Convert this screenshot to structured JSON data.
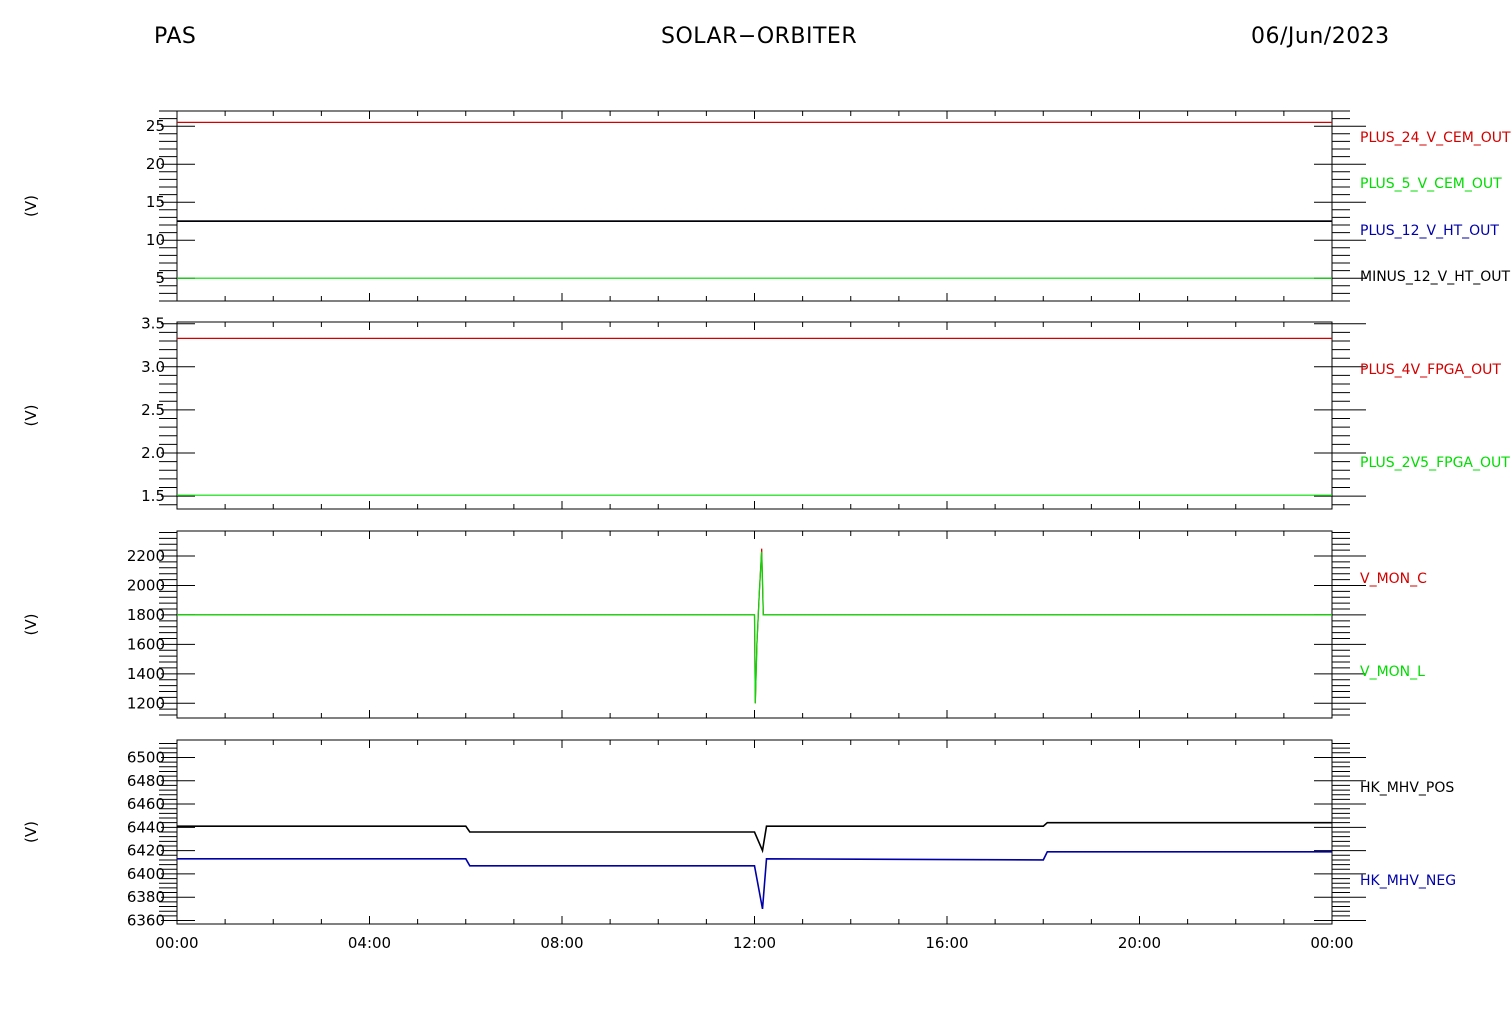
{
  "header": {
    "left": "PAS",
    "center": "SOLAR−ORBITER",
    "right": "06/Jun/2023"
  },
  "colors": {
    "red": "#d40000",
    "green": "#00dd00",
    "blue": "#0000aa",
    "black": "#000000"
  },
  "chart_data": [
    {
      "type": "line",
      "ylabel": "(V)",
      "ylim": [
        2,
        27
      ],
      "yticks": [
        5,
        10,
        15,
        20,
        25
      ],
      "x": [
        "00:00",
        "24:00"
      ],
      "series": [
        {
          "name": "PLUS_24_V_CEM_OUT",
          "color": "red",
          "values": [
            25.5,
            25.5
          ]
        },
        {
          "name": "PLUS_5_V_CEM_OUT",
          "color": "green",
          "values": [
            5.0,
            5.0
          ]
        },
        {
          "name": "PLUS_12_V_HT_OUT",
          "color": "blue",
          "values": [
            12.5,
            12.5
          ]
        },
        {
          "name": "MINUS_12_V_HT_OUT",
          "color": "black",
          "values": [
            12.5,
            12.5
          ]
        }
      ]
    },
    {
      "type": "line",
      "ylabel": "(V)",
      "ylim": [
        1.35,
        3.52
      ],
      "yticks": [
        1.5,
        2.0,
        2.5,
        3.0,
        3.5
      ],
      "ytick_labels": [
        "1.5",
        "2.0",
        "2.5",
        "3.0",
        "3.5"
      ],
      "x": [
        "00:00",
        "24:00"
      ],
      "series": [
        {
          "name": "PLUS_4V_FPGA_OUT",
          "color": "red",
          "values": [
            3.33,
            3.33
          ]
        },
        {
          "name": "PLUS_2V5_FPGA_OUT",
          "color": "green",
          "values": [
            1.51,
            1.51
          ]
        }
      ]
    },
    {
      "type": "line",
      "ylabel": "(V)",
      "ylim": [
        1100,
        2370
      ],
      "yticks": [
        1200,
        1400,
        1600,
        1800,
        2000,
        2200
      ],
      "x": [
        "00:00",
        "12:00",
        "12:01",
        "12:03",
        "12:06",
        "12:09",
        "12:11",
        "24:00"
      ],
      "series": [
        {
          "name": "V_MON_C",
          "color": "red",
          "values": [
            1800,
            1800,
            1200,
            1600,
            1950,
            2250,
            1800,
            1800
          ]
        },
        {
          "name": "V_MON_L",
          "color": "green",
          "values": [
            1800,
            1800,
            1200,
            1600,
            1950,
            2230,
            1800,
            1800
          ]
        }
      ]
    },
    {
      "type": "line",
      "ylabel": "(V)",
      "ylim": [
        6357,
        6515
      ],
      "yticks": [
        6360,
        6380,
        6400,
        6420,
        6440,
        6460,
        6480,
        6500
      ],
      "x": [
        "00:00",
        "00:05",
        "06:00",
        "06:05",
        "12:00",
        "12:10",
        "12:15",
        "18:00",
        "18:05",
        "24:00"
      ],
      "series": [
        {
          "name": "HK_MHV_POS",
          "color": "black",
          "values": [
            6441,
            6441,
            6441,
            6436,
            6436,
            6420,
            6441,
            6441,
            6444,
            6444
          ]
        },
        {
          "name": "HK_MHV_NEG",
          "color": "blue",
          "values": [
            6413,
            6413,
            6413,
            6407,
            6407,
            6370,
            6413,
            6412,
            6419,
            6419
          ]
        }
      ]
    }
  ],
  "x_axis": {
    "tick_labels": [
      "00:00",
      "04:00",
      "08:00",
      "12:00",
      "16:00",
      "20:00",
      "00:00"
    ]
  }
}
